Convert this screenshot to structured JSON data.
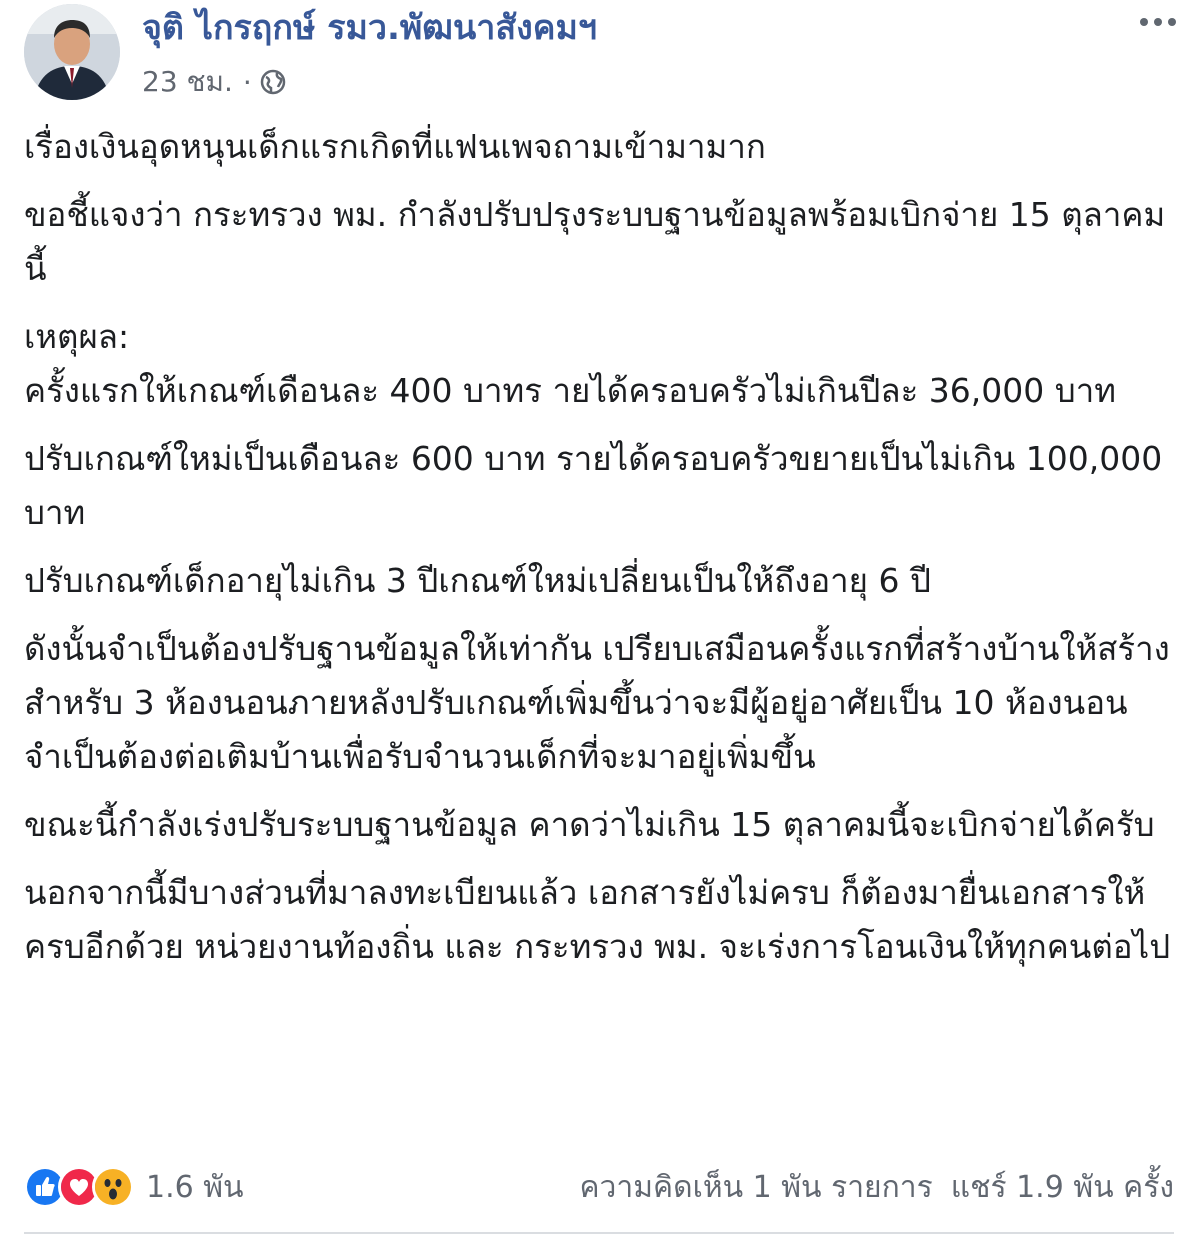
{
  "author": {
    "name": "จุติ ไกรฤกษ์ รมว.พัฒนาสังคมฯ",
    "avatar_icon": "person-avatar"
  },
  "meta": {
    "timestamp": "23 ชม.",
    "separator": "·",
    "privacy_icon": "globe-icon"
  },
  "post": {
    "paragraphs": [
      "เรื่องเงินอุดหนุนเด็กแรกเกิดที่แฟนเพจถามเข้ามามาก",
      "ขอชี้แจงว่า กระทรวง พม. กำลังปรับปรุงระบบฐานข้อมูลพร้อมเบิกจ่าย 15 ตุลาคมนี้",
      "เหตุผล:",
      "ครั้งแรกให้เกณฑ์เดือนละ 400 บาทร ายได้ครอบครัวไม่เกินปีละ 36,000 บาท",
      "ปรับเกณฑ์ใหม่เป็นเดือนละ 600 บาท รายได้ครอบครัวขยายเป็นไม่เกิน 100,000 บาท",
      "ปรับเกณฑ์เด็กอายุไม่เกิน 3 ปีเกณฑ์ใหม่เปลี่ยนเป็นให้ถึงอายุ 6 ปี",
      "ดังนั้นจำเป็นต้องปรับฐานข้อมูลให้เท่ากัน เปรียบเสมือนครั้งแรกที่สร้างบ้านให้สร้างสำหรับ 3 ห้องนอนภายหลังปรับเกณฑ์เพิ่มขึ้นว่าจะมีผู้อยู่อาศัยเป็น 10 ห้องนอน จำเป็นต้องต่อเติมบ้านเพื่อรับจำนวนเด็กที่จะมาอยู่เพิ่มขึ้น",
      "ขณะนี้กำลังเร่งปรับระบบฐานข้อมูล คาดว่าไม่เกิน 15 ตุลาคมนี้จะเบิกจ่ายได้ครับ",
      "นอกจากนี้มีบางส่วนที่มาลงทะเบียนแล้ว เอกสารยังไม่ครบ ก็ต้องมายื่นเอกสารให้ครบอีกด้วย หน่วยงานท้องถิ่น และ กระทรวง พม. จะเร่งการโอนเงินให้ทุกคนต่อไป"
    ]
  },
  "footer": {
    "reactions": [
      "like-icon",
      "love-icon",
      "wow-icon"
    ],
    "reaction_count": "1.6 พัน",
    "comments": "ความคิดเห็น 1 พัน รายการ",
    "shares": "แชร์ 1.9 พัน ครั้ง"
  },
  "colors": {
    "name": "#385898",
    "meta": "#616770",
    "text": "#1c1e21",
    "like": "#1877f2",
    "love": "#f0284a",
    "wow": "#f7b125"
  }
}
